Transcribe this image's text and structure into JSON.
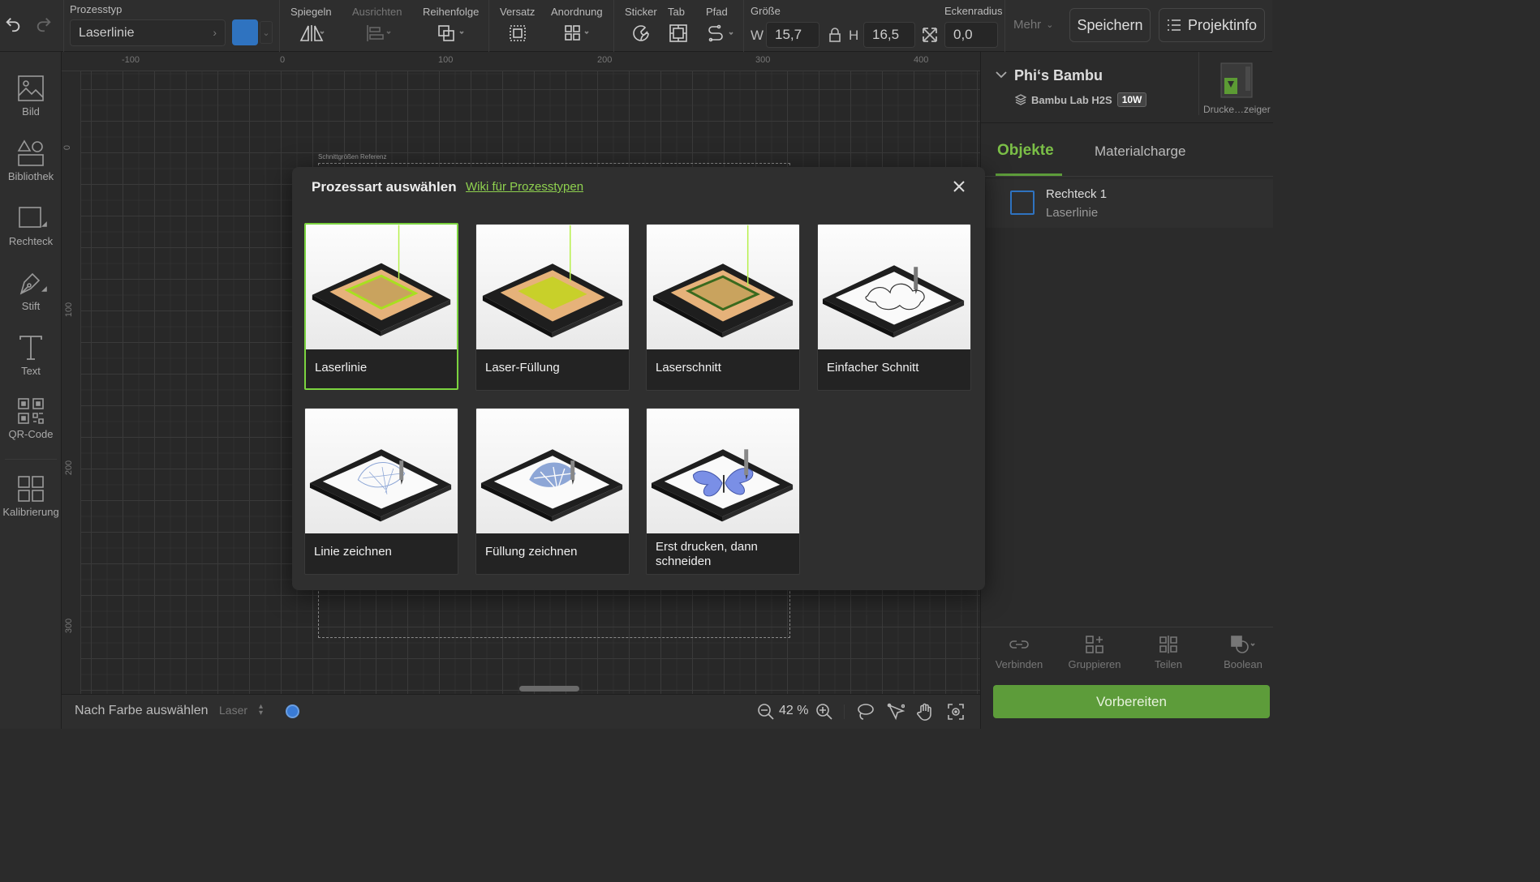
{
  "toolbar": {
    "process_type_label": "Prozesstyp",
    "process_type_value": "Laserlinie",
    "groups": {
      "mirror": "Spiegeln",
      "align": "Ausrichten",
      "order": "Reihenfolge",
      "offset": "Versatz",
      "arrange": "Anordnung",
      "sticker": "Sticker",
      "tab": "Tab",
      "path": "Pfad",
      "size": "Größe",
      "corner_radius": "Eckenradius"
    },
    "size": {
      "w_label": "W",
      "w_value": "15,7",
      "h_label": "H",
      "h_value": "16,5"
    },
    "corner_radius_value": "0,0",
    "more": "Mehr",
    "save": "Speichern",
    "project_info": "Projektinfo",
    "color_accent": "#2f73c0"
  },
  "sidebar": {
    "items": [
      {
        "label": "Bild",
        "icon": "image-icon"
      },
      {
        "label": "Bibliothek",
        "icon": "library-icon"
      },
      {
        "label": "Rechteck",
        "icon": "rectangle-icon"
      },
      {
        "label": "Stift",
        "icon": "pen-icon"
      },
      {
        "label": "Text",
        "icon": "text-icon"
      },
      {
        "label": "QR-Code",
        "icon": "qr-code-icon"
      },
      {
        "label": "Kalibrierung",
        "icon": "calibration-icon"
      }
    ]
  },
  "ruler": {
    "h_ticks": [
      "-100",
      "0",
      "100",
      "200",
      "300",
      "400"
    ],
    "v_ticks": [
      "0",
      "100",
      "200",
      "300"
    ]
  },
  "canvas": {
    "reference_label": "Schnittgrößen Referenz"
  },
  "statusbar": {
    "select_by_color": "Nach Farbe auswählen",
    "laser": "Laser",
    "zoom": "42 %",
    "dot_color": "#3a7bd5"
  },
  "right_panel": {
    "device_name": "Phi‘s Bambu",
    "device_model": "Bambu Lab H2S",
    "power_badge": "10W",
    "printer_label": "Drucke…zeiger",
    "tabs": [
      "Objekte",
      "Materialcharge"
    ],
    "object": {
      "name": "Rechteck 1",
      "type": "Laserlinie"
    },
    "actions": [
      "Verbinden",
      "Gruppieren",
      "Teilen",
      "Boolean"
    ],
    "prepare": "Vorbereiten",
    "accent_green": "#5d9c3a"
  },
  "modal": {
    "title": "Prozessart auswählen",
    "wiki_link": "Wiki für Prozesstypen",
    "options": [
      {
        "label": "Laserlinie",
        "selected": true
      },
      {
        "label": "Laser-Füllung",
        "selected": false
      },
      {
        "label": "Laserschnitt",
        "selected": false
      },
      {
        "label": "Einfacher Schnitt",
        "selected": false
      },
      {
        "label": "Linie zeichnen",
        "selected": false
      },
      {
        "label": "Füllung zeichnen",
        "selected": false
      },
      {
        "label": "Erst drucken, dann schneiden",
        "selected": false
      }
    ]
  }
}
